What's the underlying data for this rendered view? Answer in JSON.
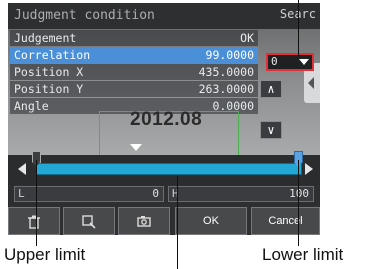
{
  "title": "Judgment condition",
  "corner_label": "Searc",
  "list": {
    "header": {
      "label": "Judgement",
      "value": "OK"
    },
    "rows": [
      {
        "label": "Correlation",
        "value": "99.0000"
      },
      {
        "label": "Position X",
        "value": "435.0000"
      },
      {
        "label": "Position Y",
        "value": "263.0000"
      },
      {
        "label": "Angle",
        "value": "0.0000"
      }
    ]
  },
  "dropdown_value": "0",
  "scroll_up": "∧",
  "scroll_down": "∨",
  "timestamp": "2012.08",
  "limits": {
    "lower_tag": "L",
    "lower_value": "0",
    "upper_tag": "H",
    "upper_value": "100"
  },
  "toolbar": {
    "ok_label": "OK",
    "cancel_label": "Cancel",
    "icons": [
      "trash-icon",
      "zoom-icon",
      "camera-icon"
    ]
  },
  "callouts": {
    "upper_limit": "Upper limit",
    "lower_limit": "Lower limit"
  },
  "colors": {
    "selected_row": "#4a8fd8",
    "slider": "#23a8d6",
    "highlight_box": "#e0303a"
  }
}
